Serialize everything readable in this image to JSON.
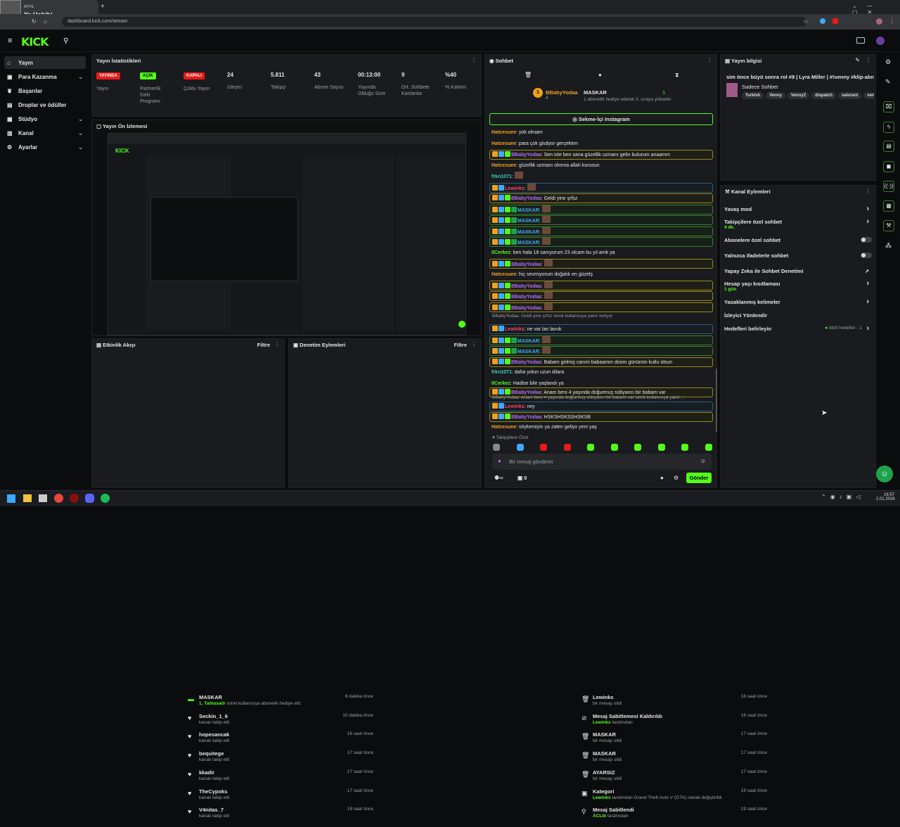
{
  "browser": {
    "profile_name_top": "ATIYE",
    "profile_name": "Ya Habibi",
    "url": "dashboard.kick.com/stream",
    "new_tab": "+"
  },
  "header": {
    "logo": "KICK"
  },
  "sidebar": {
    "items": [
      {
        "label": "Yayın",
        "icon": "home-icon",
        "chevron": ""
      },
      {
        "label": "Para Kazanma",
        "icon": "money-icon",
        "chevron": "⌄"
      },
      {
        "label": "Başarılar",
        "icon": "trophy-icon",
        "chevron": ""
      },
      {
        "label": "Droplar ve ödüller",
        "icon": "gift-icon",
        "chevron": ""
      },
      {
        "label": "Stüdyo",
        "icon": "studio-icon",
        "chevron": "⌄"
      },
      {
        "label": "Kanal",
        "icon": "channel-icon",
        "chevron": "⌄"
      },
      {
        "label": "Ayarlar",
        "icon": "gear-icon",
        "chevron": "⌄"
      }
    ]
  },
  "stats": {
    "title": "Yayın İstatistikleri",
    "items": [
      {
        "value": "YAYINDA",
        "label": "Yayın"
      },
      {
        "value": "AÇIK",
        "label": "Partnerlik Gelir Programı"
      },
      {
        "value": "KAPALI",
        "label": "Çoklu Yayın"
      },
      {
        "value": "24",
        "label": "İzleyici"
      },
      {
        "value": "5.811",
        "label": "Takipçi"
      },
      {
        "value": "43",
        "label": "Abone Sayısı"
      },
      {
        "value": "00:13:00",
        "label": "Yayında Olduğu Süre"
      },
      {
        "value": "9",
        "label": "Ort. Sohbete Katılanlar"
      },
      {
        "value": "%40",
        "label": "% Katılım"
      }
    ]
  },
  "preview": {
    "title": "Yayın Ön İzlemesi"
  },
  "activity": {
    "title": "Etkinlik Akışı",
    "filter": "Filtre",
    "rows": [
      {
        "name": "MASKAR",
        "sub_pre": "1, Tahtasatir",
        "sub": " isimli kullanıcıya abonelik hediye etti.",
        "time": "6 dakika önce",
        "icon": "sub-icon"
      },
      {
        "name": "Seckin_1_6",
        "sub_pre": "",
        "sub": "kanalı takip etti",
        "time": "10 dakika önce",
        "icon": "heart-icon"
      },
      {
        "name": "hopesancak",
        "sub_pre": "",
        "sub": "kanalı takip etti",
        "time": "16 saat önce",
        "icon": "heart-icon"
      },
      {
        "name": "bequitege",
        "sub_pre": "",
        "sub": "kanalı takip etti",
        "time": "17 saat önce",
        "icon": "heart-icon"
      },
      {
        "name": "kkadir",
        "sub_pre": "",
        "sub": "kanalı takip etti",
        "time": "17 saat önce",
        "icon": "heart-icon"
      },
      {
        "name": "TheCypoks",
        "sub_pre": "",
        "sub": "kanalı takip etti",
        "time": "17 saat önce",
        "icon": "heart-icon"
      },
      {
        "name": "V4nitas_7",
        "sub_pre": "",
        "sub": "kanalı takip etti",
        "time": "18 saat önce",
        "icon": "heart-icon"
      }
    ]
  },
  "moderation": {
    "title": "Denetim Eylemleri",
    "filter": "Filtre",
    "rows": [
      {
        "name": "Lewinks",
        "sub_pre": "",
        "sub": "bir mesajı sildi",
        "time": "16 saat önce",
        "icon": "trash-icon"
      },
      {
        "name": "Mesaj Sabitlemesi Kaldırıldı",
        "sub_pre": "Lewinks",
        "sub": " tarafından",
        "time": "16 saat önce",
        "icon": "unpin-icon"
      },
      {
        "name": "MASKAR",
        "sub_pre": "",
        "sub": "bir mesajı sildi",
        "time": "17 saat önce",
        "icon": "trash-icon"
      },
      {
        "name": "MASKAR",
        "sub_pre": "",
        "sub": "bir mesajı sildi",
        "time": "17 saat önce",
        "icon": "trash-icon"
      },
      {
        "name": "AYARSIZ",
        "sub_pre": "",
        "sub": "bir mesajı sildi",
        "time": "17 saat önce",
        "icon": "trash-icon"
      },
      {
        "name": "Kategori",
        "sub_pre": "Lewinks",
        "sub": " tarafından Grand Theft Auto V (GTA) olarak değiştirildi",
        "time": "19 saat önce",
        "icon": "category-icon"
      },
      {
        "name": "Mesaj Sabitlendi",
        "sub_pre": "ACLib",
        "sub": " tarafından",
        "time": "19 saat önce",
        "icon": "pin-icon"
      }
    ]
  },
  "chat": {
    "title": "Sohbet",
    "gift_user1": "BBabyYodaa",
    "gift_user1_count": "4",
    "gift_user2": "MASKAR",
    "gift_user2_count": "1",
    "gift_note": "1 aboneli​k hediye ederek 3. sıraya yükselin",
    "pinned": "Sekme-İçi Instagram",
    "messages": [
      {
        "user": "Hatcesuee",
        "text": "yok olmam",
        "style": "",
        "ucolor": "u-orange",
        "badges": 0
      },
      {
        "user": "Hatcesuee",
        "text": "para çok gisdyor gerçekten",
        "style": "",
        "ucolor": "u-orange",
        "badges": 0
      },
      {
        "user": "BBabyYodaa",
        "text": "Sen iste ben sana güzellik uzmanı gelin bulurum anaamm",
        "style": "hl",
        "ucolor": "u-purple",
        "badges": 3
      },
      {
        "user": "Hatcesuee",
        "text": "güzellik uzmanı olmma allah korusun",
        "style": "",
        "ucolor": "u-orange",
        "badges": 0
      },
      {
        "user": "frkn1071",
        "text": "",
        "style": "",
        "ucolor": "u-teal",
        "badges": 0
      },
      {
        "user": "Lewinks",
        "text": "",
        "style": "hlb",
        "ucolor": "u-red",
        "badges": 2
      },
      {
        "user": "BBabyYodaa",
        "text": "Geldi yine şrfsz",
        "style": "hl",
        "ucolor": "u-purple",
        "badges": 3
      },
      {
        "user": "MASKAR",
        "text": "",
        "style": "hlg",
        "ucolor": "u-blue",
        "badges": 4
      },
      {
        "user": "MASKAR",
        "text": "",
        "style": "hlg",
        "ucolor": "u-blue",
        "badges": 4
      },
      {
        "user": "MASKAR",
        "text": "",
        "style": "hlg",
        "ucolor": "u-blue",
        "badges": 4
      },
      {
        "user": "MASKAR",
        "text": "",
        "style": "hlg",
        "ucolor": "u-blue",
        "badges": 4
      },
      {
        "user": "0Cerkez",
        "text": "ben hala 18 sanıyorum 23 olcam bu yıl amk ya",
        "style": "",
        "ucolor": "u-green",
        "badges": 0
      },
      {
        "user": "BBabyYodaa",
        "text": "",
        "style": "hl",
        "ucolor": "u-purple",
        "badges": 3
      },
      {
        "user": "Hatcesuee",
        "text": "hiç sevmiyorum doğalık en güzelş",
        "style": "",
        "ucolor": "u-orange",
        "badges": 0
      },
      {
        "user": "BBabyYodaa",
        "text": "",
        "style": "hl",
        "ucolor": "u-purple",
        "badges": 3
      },
      {
        "user": "BBabyYodaa",
        "text": "",
        "style": "hl",
        "ucolor": "u-purple",
        "badges": 3
      },
      {
        "user": "BBabyYodaa",
        "text": "",
        "style": "hl",
        "ucolor": "u-purple",
        "badges": 3
      },
      {
        "user": "Lewinks",
        "text": "ne var lan lavuk",
        "style": "hlb",
        "ucolor": "u-red",
        "badges": 2
      },
      {
        "user": "MASKAR",
        "text": "",
        "style": "hlg",
        "ucolor": "u-blue",
        "badges": 4
      },
      {
        "user": "MASKAR",
        "text": "",
        "style": "hlg",
        "ucolor": "u-blue",
        "badges": 4
      },
      {
        "user": "BBabyYodaa",
        "text": "Babam gelmiş canım babaamm doom gününün kutlu olsun",
        "style": "hl",
        "ucolor": "u-purple",
        "badges": 3
      },
      {
        "user": "frkn1071",
        "text": "daha yolun uzun dilara",
        "style": "",
        "ucolor": "u-teal",
        "badges": 0
      },
      {
        "user": "0Cerkez",
        "text": "Hadise bile yaşlandı ya",
        "style": "",
        "ucolor": "u-green",
        "badges": 0
      },
      {
        "user": "BBabyYodaa",
        "text": "Anam beni 4 yaşında doğurmuş sübyancı bir babam var",
        "style": "hl",
        "ucolor": "u-purple",
        "badges": 3
      },
      {
        "user": "Lewinks",
        "text": "ney",
        "style": "hlb",
        "ucolor": "u-red",
        "badges": 2
      },
      {
        "user": "BBabyYodaa",
        "text": "HSKSHSKSSHSKSB",
        "style": "hl",
        "ucolor": "u-purple",
        "badges": 3
      },
      {
        "user": "Hatcesuee",
        "text": "söykemiyin ya zaten geliyo yeni yaş",
        "style": "",
        "ucolor": "u-orange",
        "badges": 0
      }
    ],
    "reply1": "BBabyYodaa: Geldi yine şrfsz isimli kullanıcıya yanıt veriyor",
    "reply2": "BBabyYodaa: Anam beni 4 yaşında doğurmuş sübyancı bir babam var isimli kullanıcıya yanıt ...",
    "followers_only": "Takipçilere Özel",
    "input_placeholder": "Bir mesaj gönderin",
    "viewers": "0",
    "send": "Gönder"
  },
  "info": {
    "title": "Yayın bilgisi",
    "stream_title": "sim önce büyü sonra rol #9 | Lyra Miller | #!venny #klip-alın",
    "category": "Sadece Sohbet",
    "tags": [
      "Turkish",
      "Venny",
      "VennyZ",
      "dispatch",
      "valorant",
      "ven"
    ]
  },
  "channel_actions": {
    "title": "Kanal Eylemleri",
    "items": [
      {
        "label": "Yavaş mod",
        "sub": "",
        "control": "chevron"
      },
      {
        "label": "Takipçilere özel sohbet",
        "sub": "4 dk.",
        "control": "chevron"
      },
      {
        "label": "Abonelere özel sohbet",
        "sub": "",
        "control": "toggle"
      },
      {
        "label": "Yalnızca ifadelerle sohbet",
        "sub": "",
        "control": "toggle"
      },
      {
        "label": "Yapay Zeka ile Sohbet Denetimi",
        "sub": "",
        "control": "external"
      },
      {
        "label": "Hesap yaşı kısıtlaması",
        "sub": "1 gün",
        "control": "chevron"
      },
      {
        "label": "Yasaklanmış kelimeler",
        "sub": "",
        "control": "chevron"
      },
      {
        "label": "İzleyici Yönlendir",
        "sub": "",
        "control": "none"
      },
      {
        "label": "Hedefleri belirleyin",
        "sub": "",
        "control": "goal"
      }
    ],
    "goal_status": "Aktif hedefler - 1"
  },
  "taskbar": {
    "time": "16:57",
    "date": "2.01.2026"
  },
  "colors": {
    "accent": "#53fc18",
    "panel": "#191b1f",
    "live": "#e91916"
  }
}
